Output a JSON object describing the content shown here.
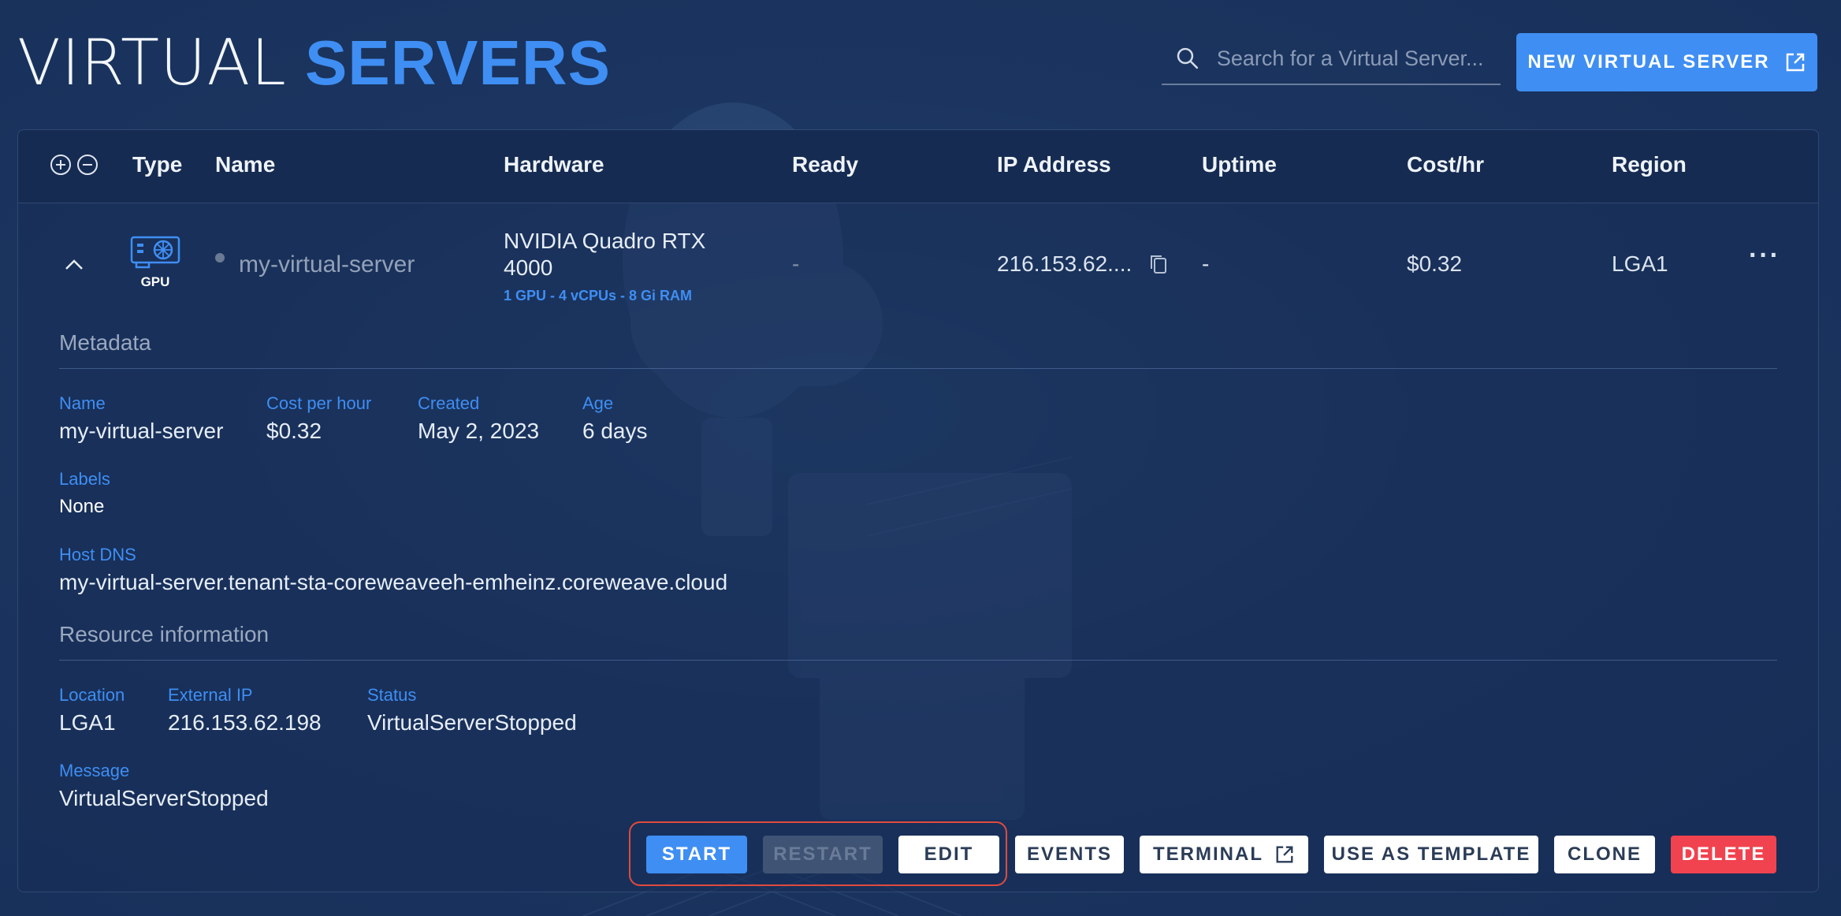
{
  "header": {
    "title_light": "VIRTUAL",
    "title_bold": "SERVERS",
    "search_placeholder": "Search for a Virtual Server...",
    "new_button_label": "NEW VIRTUAL SERVER"
  },
  "table": {
    "columns": [
      "Type",
      "Name",
      "Hardware",
      "Ready",
      "IP Address",
      "Uptime",
      "Cost/hr",
      "Region"
    ],
    "row": {
      "type_label": "GPU",
      "name": "my-virtual-server",
      "hardware_name": "NVIDIA Quadro RTX 4000",
      "hardware_specs": "1 GPU - 4 vCPUs - 8 Gi RAM",
      "ready": "-",
      "ip_address": "216.153.62....",
      "uptime": "-",
      "cost_hr": "$0.32",
      "region": "LGA1",
      "more_menu": "···"
    }
  },
  "details": {
    "metadata_title": "Metadata",
    "metadata": {
      "name_label": "Name",
      "name_value": "my-virtual-server",
      "cost_label": "Cost per hour",
      "cost_value": "$0.32",
      "created_label": "Created",
      "created_value": "May 2, 2023",
      "age_label": "Age",
      "age_value": "6 days",
      "labels_label": "Labels",
      "labels_value": "None",
      "dns_label": "Host DNS",
      "dns_value": "my-virtual-server.tenant-sta-coreweaveeh-emheinz.coreweave.cloud"
    },
    "resource_title": "Resource information",
    "resource": {
      "location_label": "Location",
      "location_value": "LGA1",
      "external_ip_label": "External IP",
      "external_ip_value": "216.153.62.198",
      "status_label": "Status",
      "status_value": "VirtualServerStopped",
      "message_label": "Message",
      "message_value": "VirtualServerStopped"
    }
  },
  "actions": {
    "start": "START",
    "restart": "RESTART",
    "edit": "EDIT",
    "events": "EVENTS",
    "terminal": "TERMINAL",
    "use_as_template": "USE AS TEMPLATE",
    "clone": "CLONE",
    "delete": "DELETE"
  },
  "colors": {
    "accent": "#3f8ef3",
    "danger": "#f0434f",
    "background": "#1b3560"
  }
}
